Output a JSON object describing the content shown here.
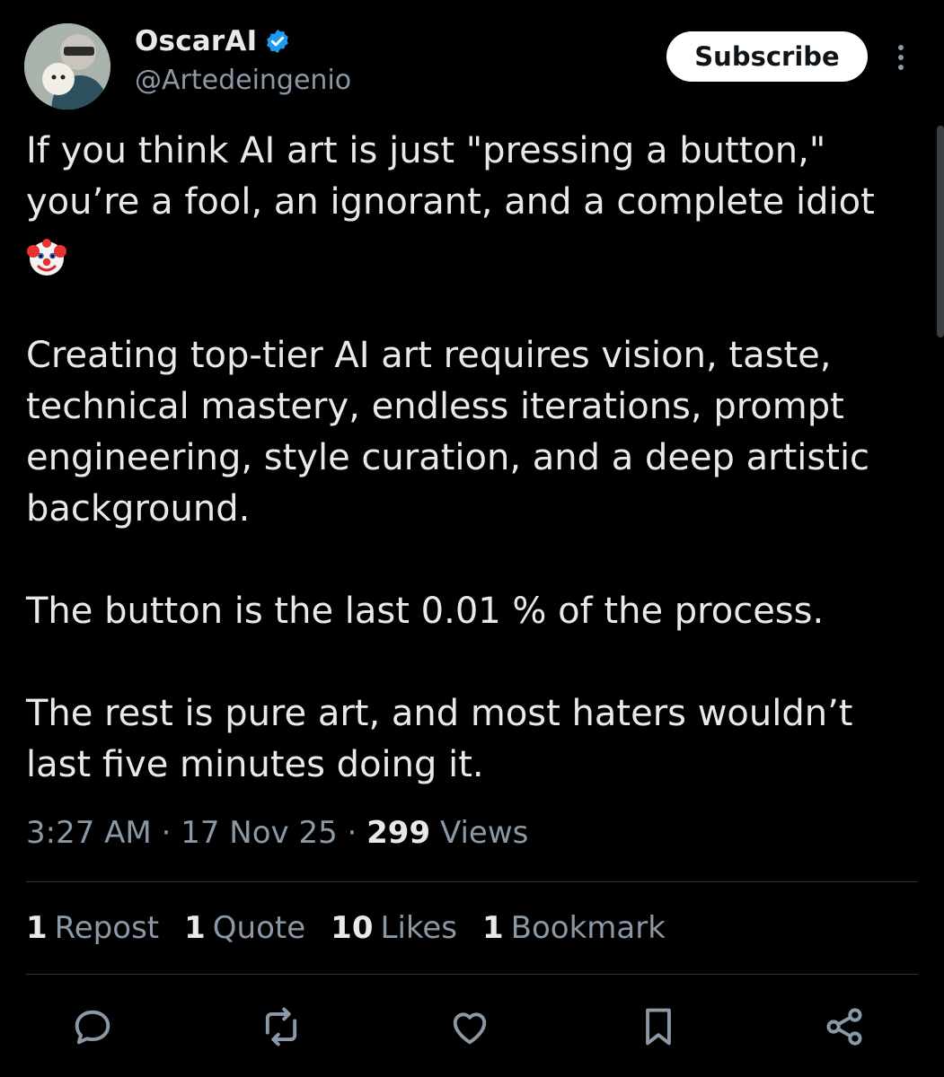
{
  "author": {
    "display_name": "OscarAI",
    "handle": "@Artedeingenio",
    "avatar_icon": "avatar-photo",
    "verified_icon": "verified-badge-icon",
    "verified_color": "#1d9bf0"
  },
  "header": {
    "subscribe_label": "Subscribe",
    "more_icon": "more-vertical-icon"
  },
  "tweet": {
    "line1": "If you think AI art is just \"pressing a button,\"",
    "line2": "you’re a fool, an ignorant, and a complete idiot",
    "emoji_icon": "clown-face-icon",
    "para2": "Creating top-tier AI art requires vision, taste, technical mastery, endless iterations, prompt engineering, style curation, and a deep artistic background.",
    "para3": "The button is the last 0.01 % of the process.",
    "para4": "The rest is pure art, and most haters wouldn’t last five minutes doing it."
  },
  "meta": {
    "time": "3:27 AM",
    "sep1": "·",
    "date": "17 Nov 25",
    "sep2": "·",
    "views_count": "299",
    "views_label": "Views"
  },
  "stats": {
    "reposts_count": "1",
    "reposts_label": "Repost",
    "quotes_count": "1",
    "quotes_label": "Quote",
    "likes_count": "10",
    "likes_label": "Likes",
    "bookmarks_count": "1",
    "bookmarks_label": "Bookmark"
  },
  "actions": [
    "reply-icon",
    "repost-icon",
    "like-icon",
    "bookmark-icon",
    "share-icon"
  ],
  "colors": {
    "background": "#000000",
    "text": "#e7e9ea",
    "secondary_text": "#8b98a5",
    "divider": "#2f3336",
    "action_icon": "#8b98a5"
  }
}
